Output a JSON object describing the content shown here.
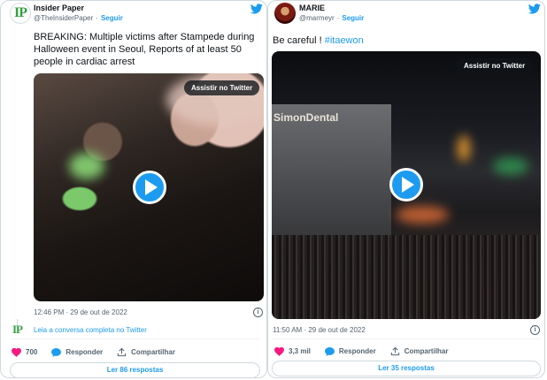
{
  "tweets": [
    {
      "author_name": "Insider Paper",
      "author_handle": "@TheInsiderPaper",
      "separator": "·",
      "follow_label": "Seguir",
      "avatar_initials": "IP",
      "text": "BREAKING: Multiple victims after Stampede during Halloween event in Seoul, Reports of at least 50 people in cardiac arrest",
      "watch_label": "Assistir no Twitter",
      "timestamp": "12:46 PM · 29 de out de 2022",
      "read_conversation": "Leia a conversa completa no Twitter",
      "likes": "700",
      "reply_label": "Responder",
      "share_label": "Compartilhar",
      "replies_button": "Ler 86 respostas"
    },
    {
      "author_name": "MARIE",
      "author_handle": "@marmeyr",
      "separator": "·",
      "follow_label": "Seguir",
      "text_main": "Be careful ! ",
      "hashtag": "#itaewon",
      "video_sign": "SimonDental",
      "watch_label": "Assistir no Twitter",
      "timestamp": "11:50 AM · 29 de out de 2022",
      "likes": "3,3 mil",
      "reply_label": "Responder",
      "share_label": "Compartilhar",
      "replies_button": "Ler 35 respostas"
    }
  ],
  "colors": {
    "accent": "#1d9bf0",
    "like": "#f91880",
    "text": "#0f1419",
    "muted": "#536471",
    "border": "#cfd9de",
    "insider_green": "#35a043"
  },
  "icons": [
    "twitter-bird-icon",
    "play-icon",
    "info-icon",
    "heart-icon",
    "reply-bubble-icon",
    "share-icon"
  ]
}
